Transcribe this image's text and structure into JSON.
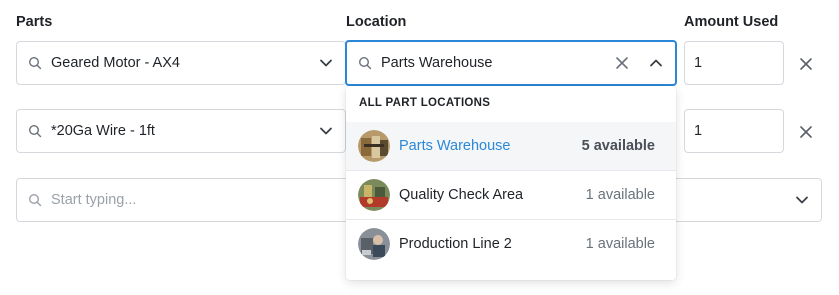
{
  "headers": {
    "parts": "Parts",
    "location": "Location",
    "amount": "Amount Used"
  },
  "rows": [
    {
      "part": "Geared Motor - AX4",
      "location": "Parts Warehouse",
      "amount": "1"
    },
    {
      "part": "*20Ga Wire - 1ft",
      "amount": "1"
    }
  ],
  "new_row": {
    "placeholder": "Start typing..."
  },
  "dropdown": {
    "title": "ALL PART LOCATIONS",
    "options": [
      {
        "name": "Parts Warehouse",
        "count": "5 available",
        "selected": true,
        "avatar": "warehouse-photo"
      },
      {
        "name": "Quality Check Area",
        "count": "1 available",
        "selected": false,
        "avatar": "quality-area-photo"
      },
      {
        "name": "Production Line 2",
        "count": "1 available",
        "selected": false,
        "avatar": "production-line-photo"
      }
    ]
  },
  "colors": {
    "accent": "#2b88d8",
    "border": "#d5d9de",
    "selected_bg": "#f4f6f8"
  },
  "icons": [
    "search-icon",
    "chevron-down-icon",
    "chevron-up-icon",
    "clear-icon",
    "remove-row-icon"
  ]
}
